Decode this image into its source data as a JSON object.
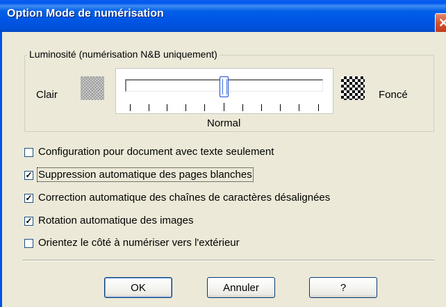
{
  "window": {
    "title": "Option Mode de numérisation",
    "close_glyph": "✕"
  },
  "brightness": {
    "group_label": "Luminosité (numérisation N&B uniquement)",
    "light_label": "Clair",
    "dark_label": "Foncé",
    "normal_label": "Normal",
    "slider_position_fraction": 0.5,
    "tick_count": 11
  },
  "options": [
    {
      "label": "Configuration pour document avec texte seulement",
      "checked": false,
      "mark": ""
    },
    {
      "label": "Suppression automatique des pages blanches",
      "checked": true,
      "mark": "✓"
    },
    {
      "label": "Correction automatique des chaînes de caractères désalignées",
      "checked": true,
      "mark": "✓"
    },
    {
      "label": "Rotation automatique des images",
      "checked": true,
      "mark": "✓"
    },
    {
      "label": "Orientez le côté à numériser vers l'extérieur",
      "checked": false,
      "mark": ""
    }
  ],
  "buttons": {
    "ok": "OK",
    "cancel": "Annuler",
    "help": "?"
  }
}
